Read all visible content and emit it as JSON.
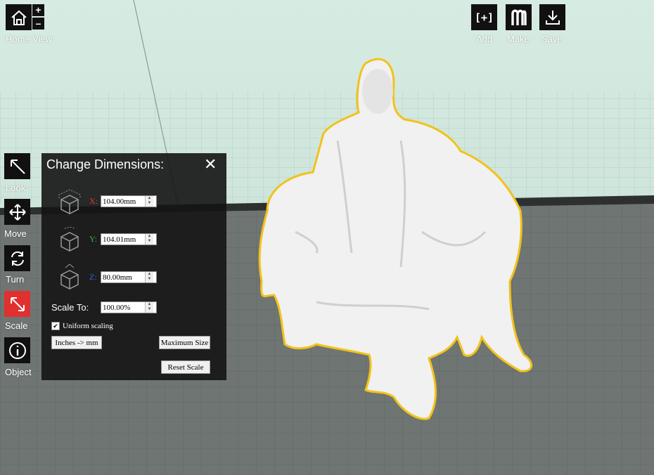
{
  "viewport": {
    "colors": {
      "sky": "#d4e9e0",
      "grid_far": "#b9d4c8",
      "floor": "#6f7572",
      "model": "#f1f1f1",
      "outline": "#f2c21a"
    }
  },
  "top_left": {
    "home_label": "Home View",
    "zoom_in": "+",
    "zoom_out": "–"
  },
  "top_right": {
    "add_label": "Add",
    "add_glyph": "[+]",
    "make_label": "Make",
    "save_label": "Save"
  },
  "left_toolbar": {
    "items": [
      {
        "label": "Look",
        "icon": "look-arrow-icon",
        "active": false
      },
      {
        "label": "Move",
        "icon": "move-arrows-icon",
        "active": false
      },
      {
        "label": "Turn",
        "icon": "rotate-icon",
        "active": false
      },
      {
        "label": "Scale",
        "icon": "scale-arrow-icon",
        "active": true,
        "color": "#e03030"
      },
      {
        "label": "Object",
        "icon": "info-icon",
        "active": false
      }
    ]
  },
  "dimensions_panel": {
    "title": "Change Dimensions:",
    "close": "✕",
    "x": {
      "axis": "X:",
      "value": "104.00mm",
      "color": "#e23b2e"
    },
    "y": {
      "axis": "Y:",
      "value": "104.01mm",
      "color": "#34b24a"
    },
    "z": {
      "axis": "Z:",
      "value": "80.00mm",
      "color": "#2f6be0"
    },
    "scale_to_label": "Scale To:",
    "scale_value": "100.00%",
    "uniform_label": "Uniform scaling",
    "uniform_checked": true,
    "inches_button": "Inches -> mm",
    "max_size_button": "Maximum Size",
    "reset_button": "Reset Scale"
  }
}
